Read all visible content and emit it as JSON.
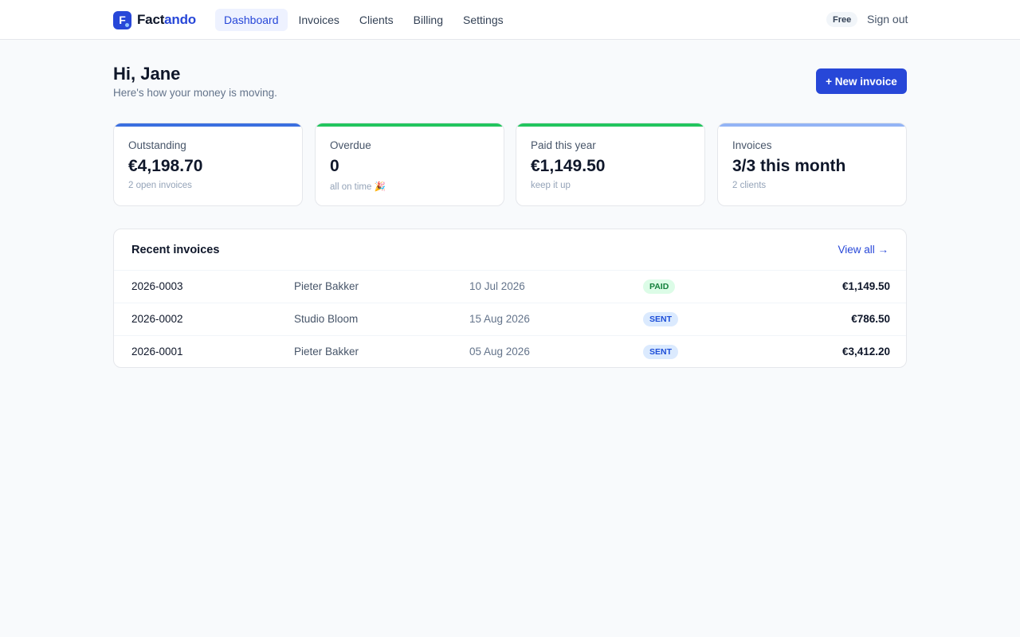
{
  "brand": {
    "mark": "F",
    "name_part1": "Fact",
    "name_part2": "ando"
  },
  "nav": {
    "items": [
      {
        "label": "Dashboard",
        "active": true
      },
      {
        "label": "Invoices",
        "active": false
      },
      {
        "label": "Clients",
        "active": false
      },
      {
        "label": "Billing",
        "active": false
      },
      {
        "label": "Settings",
        "active": false
      }
    ],
    "plan_badge": "Free",
    "signout_label": "Sign out"
  },
  "header": {
    "greeting": "Hi, Jane",
    "subtitle": "Here's how your money is moving.",
    "new_invoice_label": "+ New invoice"
  },
  "stats": [
    {
      "label": "Outstanding",
      "value": "€4,198.70",
      "note": "2 open invoices",
      "accent": "#3b6fe0"
    },
    {
      "label": "Overdue",
      "value": "0",
      "note": "all on time 🎉",
      "accent": "#22c55e"
    },
    {
      "label": "Paid this year",
      "value": "€1,149.50",
      "note": "keep it up",
      "accent": "#22c55e"
    },
    {
      "label": "Invoices",
      "value": "3/3 this month",
      "note": "2 clients",
      "accent": "#93b4f5"
    }
  ],
  "recent": {
    "title": "Recent invoices",
    "view_all_label": "View all →",
    "rows": [
      {
        "number": "2026-0003",
        "client": "Pieter Bakker",
        "date": "10 Jul 2026",
        "status": "PAID",
        "amount": "€1,149.50"
      },
      {
        "number": "2026-0002",
        "client": "Studio Bloom",
        "date": "15 Aug 2026",
        "status": "SENT",
        "amount": "€786.50"
      },
      {
        "number": "2026-0001",
        "client": "Pieter Bakker",
        "date": "05 Aug 2026",
        "status": "SENT",
        "amount": "€3,412.20"
      }
    ]
  },
  "colors": {
    "brand": "#2747d8",
    "paid_bg": "#dcfce7",
    "paid_fg": "#15803d",
    "sent_bg": "#dbeafe",
    "sent_fg": "#1d4ed8"
  }
}
